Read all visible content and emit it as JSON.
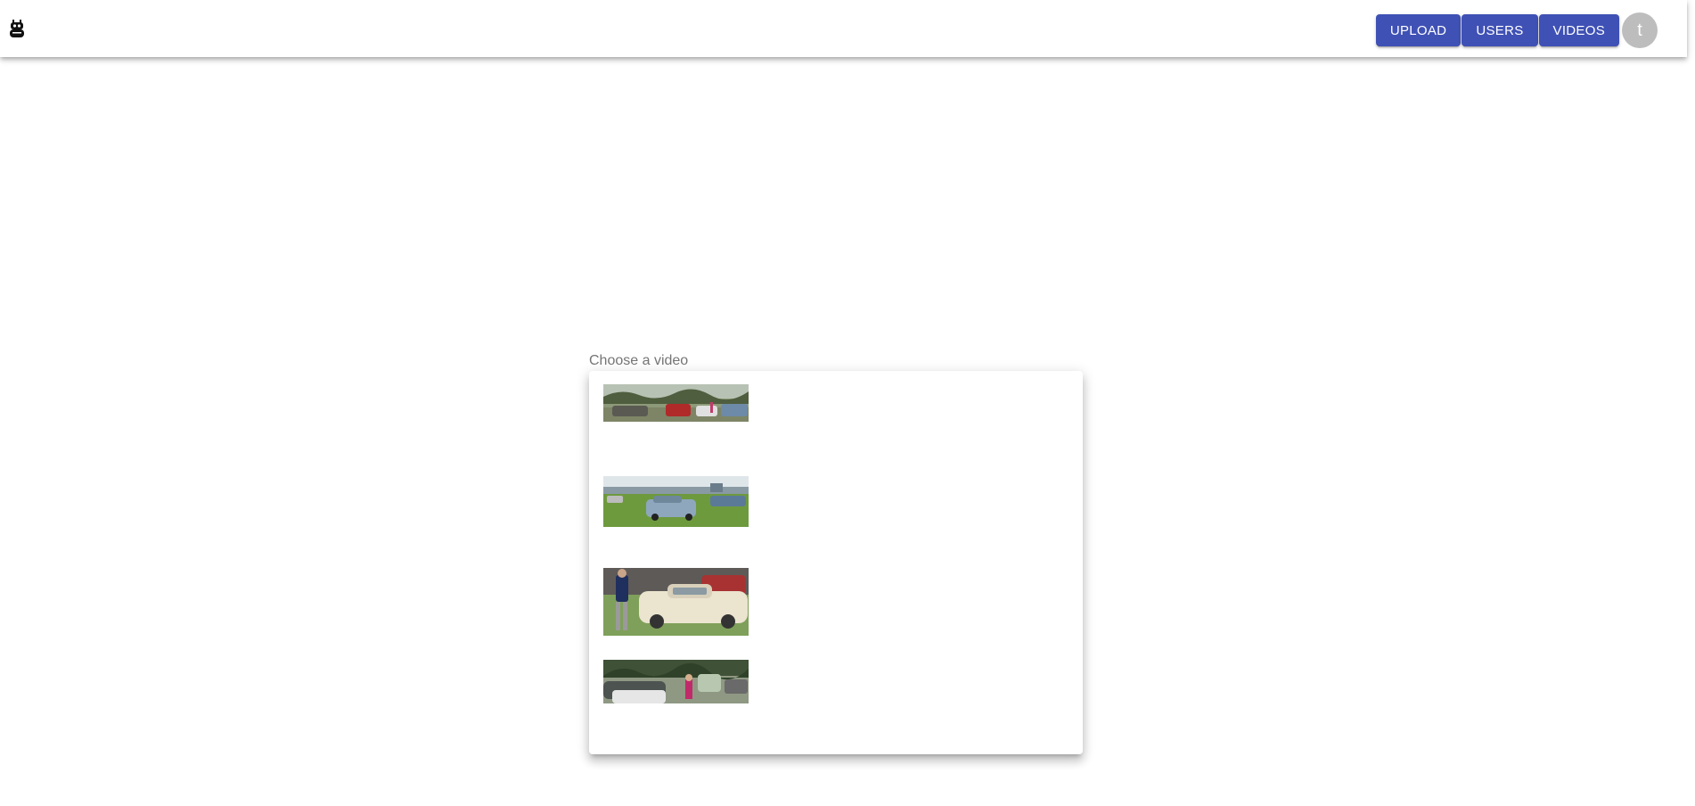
{
  "header": {
    "logo_icon": "robot-icon",
    "nav": {
      "upload_label": "UPLOAD",
      "users_label": "USERS",
      "videos_label": "VIDEOS"
    },
    "avatar_initial": "t",
    "accent_color": "#3f51b5"
  },
  "video_select": {
    "label": "Choose a video",
    "options": [
      {
        "name": "video-thumbnail-1",
        "description_icon": "car-show-thumbnail"
      },
      {
        "name": "video-thumbnail-2",
        "description_icon": "car-show-thumbnail"
      },
      {
        "name": "video-thumbnail-3",
        "description_icon": "car-show-thumbnail"
      },
      {
        "name": "video-thumbnail-4",
        "description_icon": "car-show-thumbnail"
      }
    ]
  }
}
